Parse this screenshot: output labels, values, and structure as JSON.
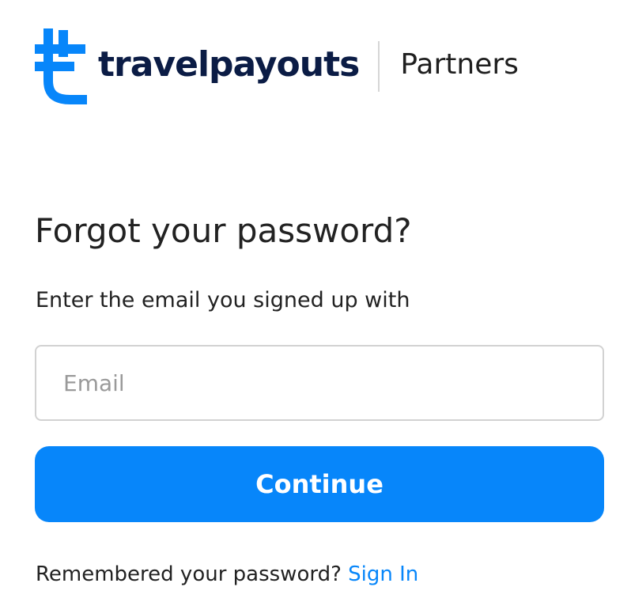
{
  "header": {
    "logo_icon": "travelpayouts-logo-icon",
    "brand_name": "travelpayouts",
    "section_label": "Partners"
  },
  "form": {
    "title": "Forgot your password?",
    "subtitle": "Enter the email you signed up with",
    "email_placeholder": "Email",
    "email_value": "",
    "continue_label": "Continue"
  },
  "footer": {
    "prompt": "Remembered your password?",
    "signin_label": "Sign In"
  },
  "colors": {
    "accent": "#0786fa",
    "brand_text": "#0b1c45",
    "text": "#222222",
    "placeholder": "#9a9a9a",
    "border": "#d2d2d2"
  }
}
